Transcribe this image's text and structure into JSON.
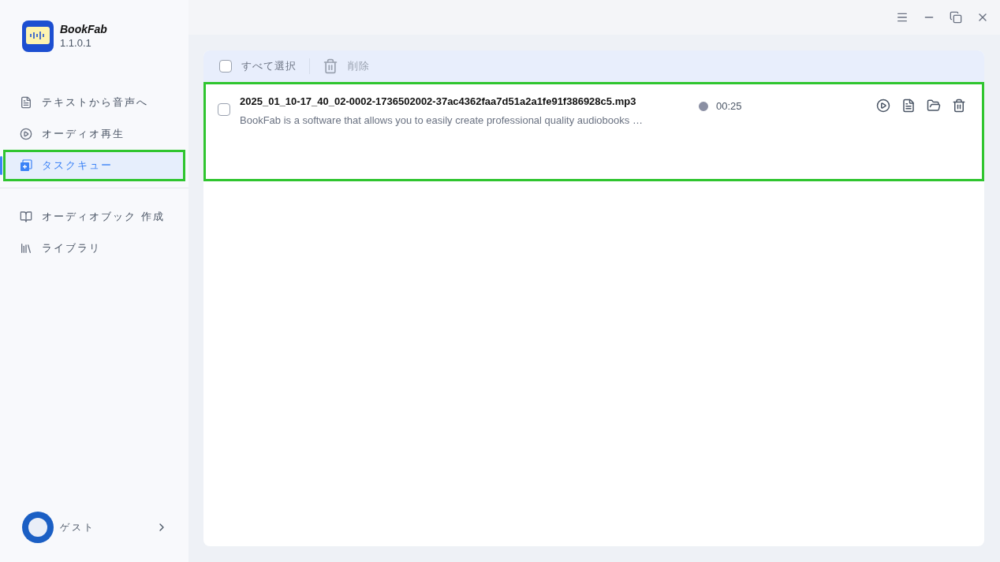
{
  "app": {
    "name": "BookFab",
    "version": "1.1.0.1"
  },
  "sidebar": {
    "groups": [
      {
        "items": [
          {
            "label": "テキストから音声へ",
            "kind": "document",
            "selected": false,
            "highlighted": false
          },
          {
            "label": "オーディオ再生",
            "kind": "play",
            "selected": false,
            "highlighted": false
          },
          {
            "label": "タスクキュー",
            "kind": "queue",
            "selected": true,
            "highlighted": true
          }
        ]
      },
      {
        "items": [
          {
            "label": "オーディオブック 作成",
            "kind": "book",
            "selected": false,
            "highlighted": false
          },
          {
            "label": "ライブラリ",
            "kind": "library",
            "selected": false,
            "highlighted": false
          }
        ]
      }
    ],
    "user": {
      "name": "ゲスト"
    }
  },
  "toolbar": {
    "select_all": {
      "label": "すべて選択",
      "checked": false
    },
    "delete": {
      "label": "削除",
      "disabled": true
    }
  },
  "tasks": [
    {
      "filename": "2025_01_10-17_40_02-0002-1736502002-37ac4362faa7d51a2a1fe91f386928c5.mp3",
      "description": "BookFab is a software that allows you to easily create professional quality audiobooks …",
      "duration": "00:25",
      "checked": false,
      "highlighted": true
    }
  ]
}
